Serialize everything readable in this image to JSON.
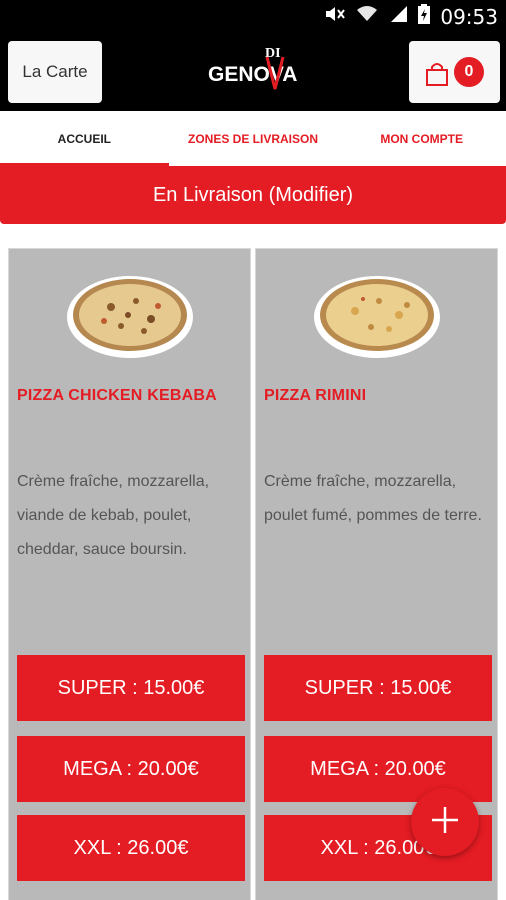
{
  "status_bar": {
    "time": "09:53",
    "icons": [
      "mute-icon",
      "wifi-icon",
      "signal-icon",
      "battery-icon"
    ]
  },
  "header": {
    "menu_label": "La Carte",
    "logo_text_top": "DI",
    "logo_text_main": "GENOVA",
    "cart_count": "0",
    "cart_icon": "shopping-bag-icon"
  },
  "tabs": [
    {
      "label": "ACCUEIL",
      "active": true
    },
    {
      "label": "ZONES DE LIVRAISON",
      "active": false
    },
    {
      "label": "MON COMPTE",
      "active": false
    }
  ],
  "delivery_banner": "En Livraison (Modifier)",
  "products": [
    {
      "name": "PIZZA CHICKEN KEBABA",
      "description": "Crème fraîche, mozzarella, viande de kebab, poulet, cheddar, sauce boursin.",
      "prices": [
        "SUPER : 15.00€",
        "MEGA : 20.00€",
        "XXL : 26.00€"
      ]
    },
    {
      "name": "PIZZA RIMINI",
      "description": "Crème fraîche, mozzarella, poulet fumé, pommes de terre.",
      "prices": [
        "SUPER : 15.00€",
        "MEGA : 20.00€",
        "XXL : 26.00€"
      ]
    }
  ],
  "fab_icon": "plus-icon",
  "colors": {
    "brand": "#e41c23",
    "card_bg": "#b9b9b9",
    "header_bg": "#000000"
  }
}
